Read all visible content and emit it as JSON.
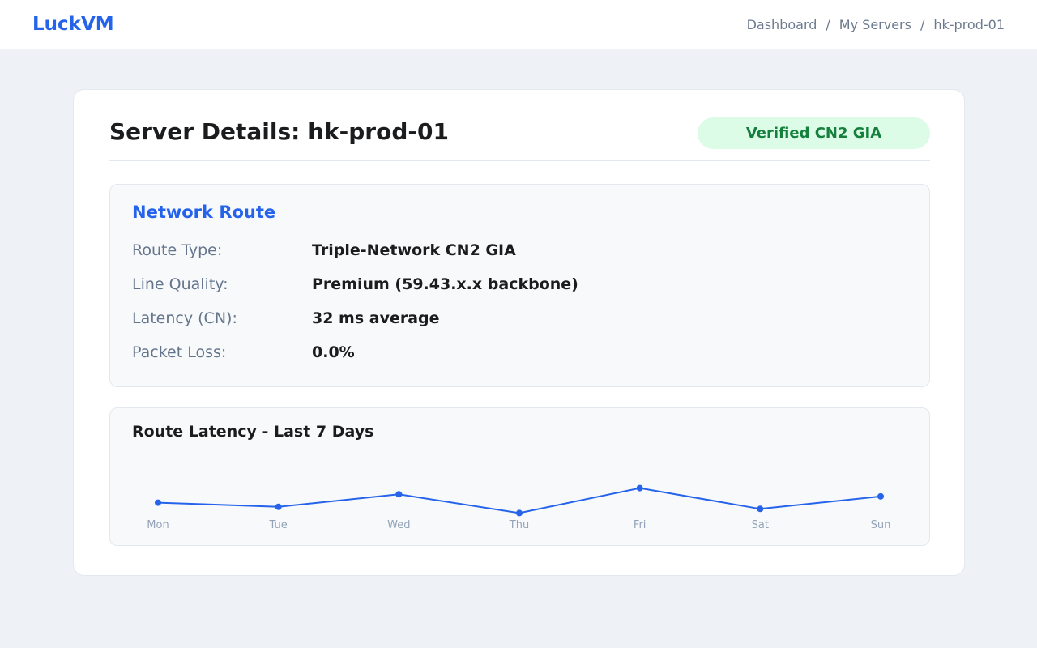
{
  "header": {
    "logo": "LuckVM",
    "breadcrumb": {
      "separator": "/",
      "items": [
        "Dashboard",
        "My Servers",
        "hk-prod-01"
      ]
    }
  },
  "server": {
    "title": "Server Details: hk-prod-01",
    "badge": "Verified CN2 GIA"
  },
  "network_route": {
    "title": "Network Route",
    "rows": [
      {
        "label": "Route Type:",
        "value": "Triple-Network CN2 GIA"
      },
      {
        "label": "Line Quality:",
        "value": "Premium (59.43.x.x backbone)"
      },
      {
        "label": "Latency (CN):",
        "value": "32 ms average"
      },
      {
        "label": "Packet Loss:",
        "value": "0.0%"
      }
    ]
  },
  "latency_chart": {
    "title": "Route Latency - Last 7 Days"
  },
  "colors": {
    "accent": "#2563eb",
    "badge_bg": "#dcfce7",
    "badge_text": "#15803d",
    "background": "#eef1f5"
  },
  "chart_data": {
    "type": "line",
    "title": "Route Latency - Last 7 Days",
    "categories": [
      "Mon",
      "Tue",
      "Wed",
      "Thu",
      "Fri",
      "Sat",
      "Sun"
    ],
    "series": [
      {
        "values": [
          32,
          31,
          34,
          29.5,
          35.5,
          30.5,
          33.5
        ]
      }
    ],
    "unit": "ms",
    "ylim": [
      29,
      36
    ],
    "grid": false,
    "legend": "none"
  }
}
